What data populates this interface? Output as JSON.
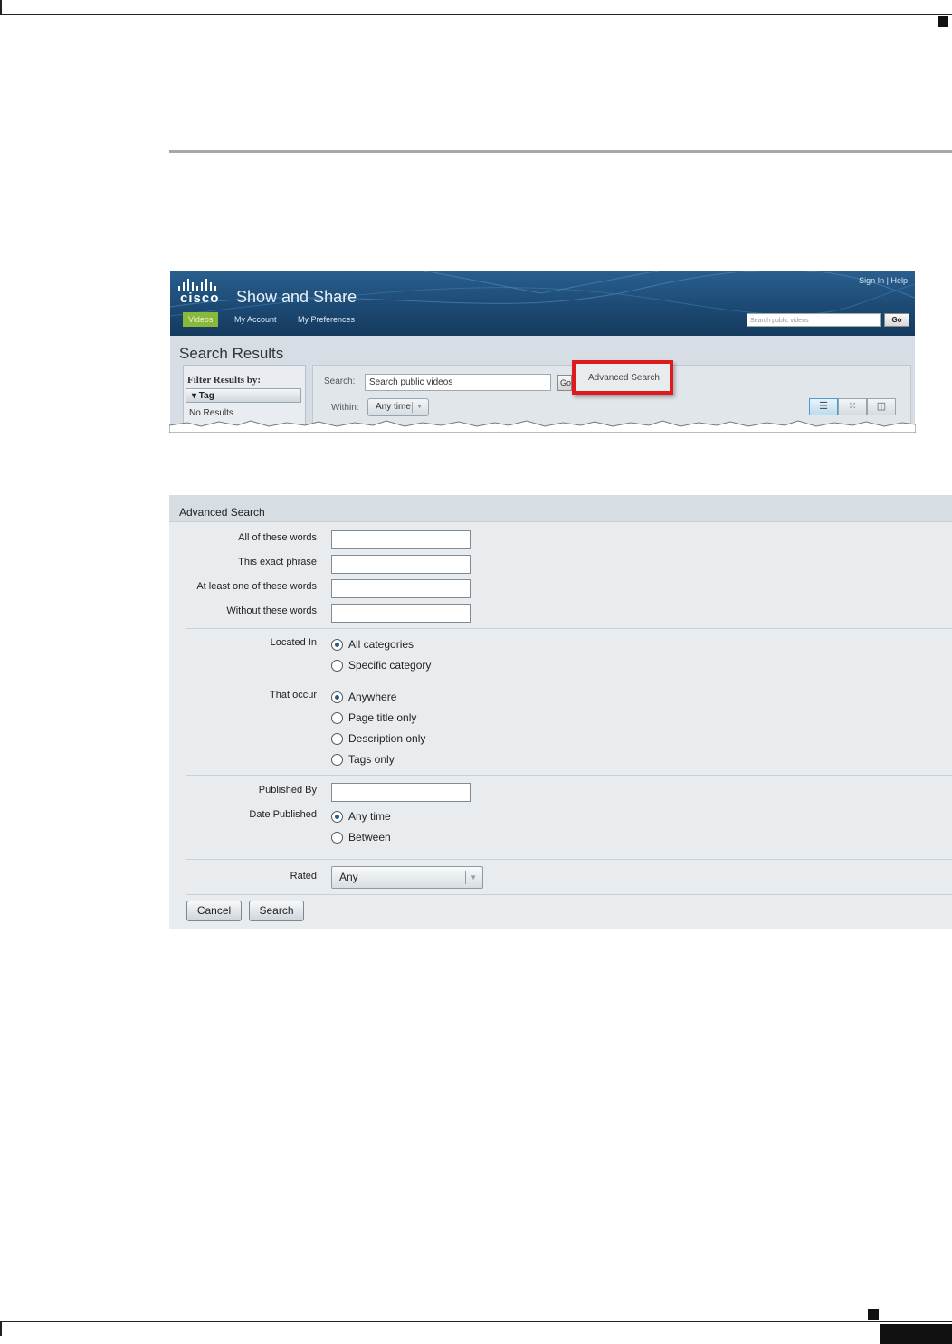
{
  "show_and_share": {
    "logo_text": "cisco",
    "app_title": "Show and Share",
    "signin": "Sign In",
    "help": "Help",
    "nav": {
      "videos": "Videos",
      "my_account": "My Account",
      "my_preferences": "My Preferences",
      "search_placeholder": "Search public videos",
      "go": "Go"
    },
    "page_title": "Search Results",
    "filter": {
      "title": "Filter Results by:",
      "tag_header": "▾ Tag",
      "no_results": "No Results"
    },
    "search_label": "Search:",
    "search_value": "Search public videos",
    "go_small": "Go",
    "advanced_search_link": "Advanced Search",
    "within_label": "Within:",
    "within_value": "Any time",
    "view_icons": [
      "list-view-icon",
      "grid-view-icon",
      "detail-view-icon"
    ],
    "highlight_color": "#e01a1a"
  },
  "advanced_search": {
    "title": "Advanced Search",
    "words": {
      "all_label": "All of these words",
      "exact_label": "This exact phrase",
      "one_label": "At least one of these words",
      "without_label": "Without these words"
    },
    "located_in": {
      "label": "Located In",
      "options": [
        "All categories",
        "Specific category"
      ],
      "selected": "All categories"
    },
    "that_occur": {
      "label": "That occur",
      "options": [
        "Anywhere",
        "Page title only",
        "Description only",
        "Tags only"
      ],
      "selected": "Anywhere"
    },
    "published_by_label": "Published By",
    "date_published": {
      "label": "Date Published",
      "options": [
        "Any time",
        "Between"
      ],
      "selected": "Any time"
    },
    "rated": {
      "label": "Rated",
      "value": "Any"
    },
    "cancel_label": "Cancel",
    "search_label": "Search"
  }
}
